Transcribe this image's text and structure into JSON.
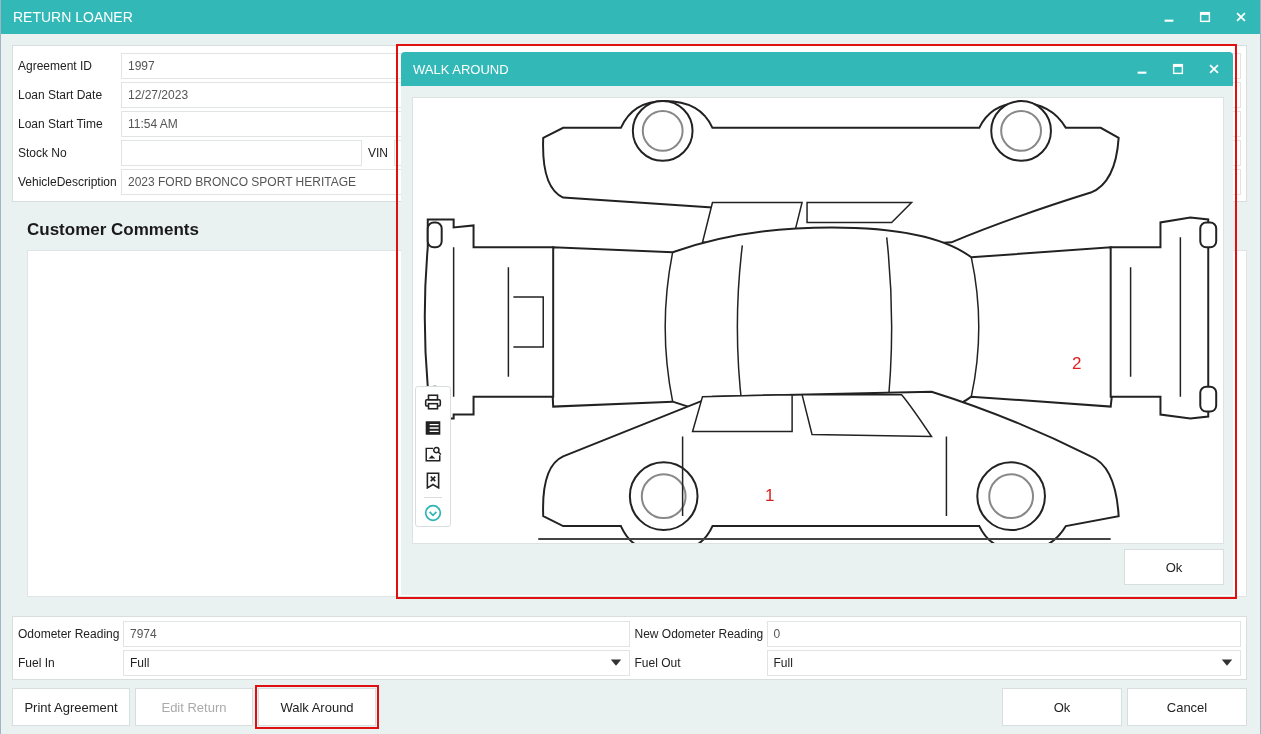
{
  "window": {
    "title": "RETURN LOANER"
  },
  "form": {
    "fields": [
      {
        "label": "Agreement ID",
        "value": "1997",
        "kind": "text"
      },
      {
        "label": "Loan Start Date",
        "value": "12/27/2023",
        "kind": "text"
      },
      {
        "label": "Loan Start Time",
        "value": "11:54 AM",
        "kind": "text"
      },
      {
        "label": "Stock No",
        "kind": "split",
        "second_label": "VIN"
      },
      {
        "label": "VehicleDescription",
        "value": "2023 FORD BRONCO SPORT HERITAGE",
        "kind": "text"
      }
    ]
  },
  "comments": {
    "heading": "Customer Comments"
  },
  "readings": [
    {
      "items": [
        {
          "label": "Odometer Reading",
          "value": "7974",
          "kind": "text"
        },
        {
          "label": "New Odometer Reading",
          "value": "0",
          "kind": "text"
        }
      ]
    },
    {
      "items": [
        {
          "label": "Fuel In",
          "value": "Full",
          "kind": "dropdown"
        },
        {
          "label": "Fuel Out",
          "value": "Full",
          "kind": "dropdown"
        }
      ]
    }
  ],
  "buttons_left": [
    {
      "label": "Print Agreement",
      "disabled": false,
      "highlighted": false
    },
    {
      "label": "Edit Return",
      "disabled": true,
      "highlighted": false
    },
    {
      "label": "Walk Around",
      "disabled": false,
      "highlighted": true
    }
  ],
  "buttons_right": [
    {
      "label": "Ok",
      "disabled": false
    },
    {
      "label": "Cancel",
      "disabled": false
    }
  ],
  "dialog": {
    "title": "WALK AROUND",
    "highlighted": true,
    "markers": [
      {
        "label": "1"
      },
      {
        "label": "2"
      }
    ],
    "ok": "Ok"
  }
}
